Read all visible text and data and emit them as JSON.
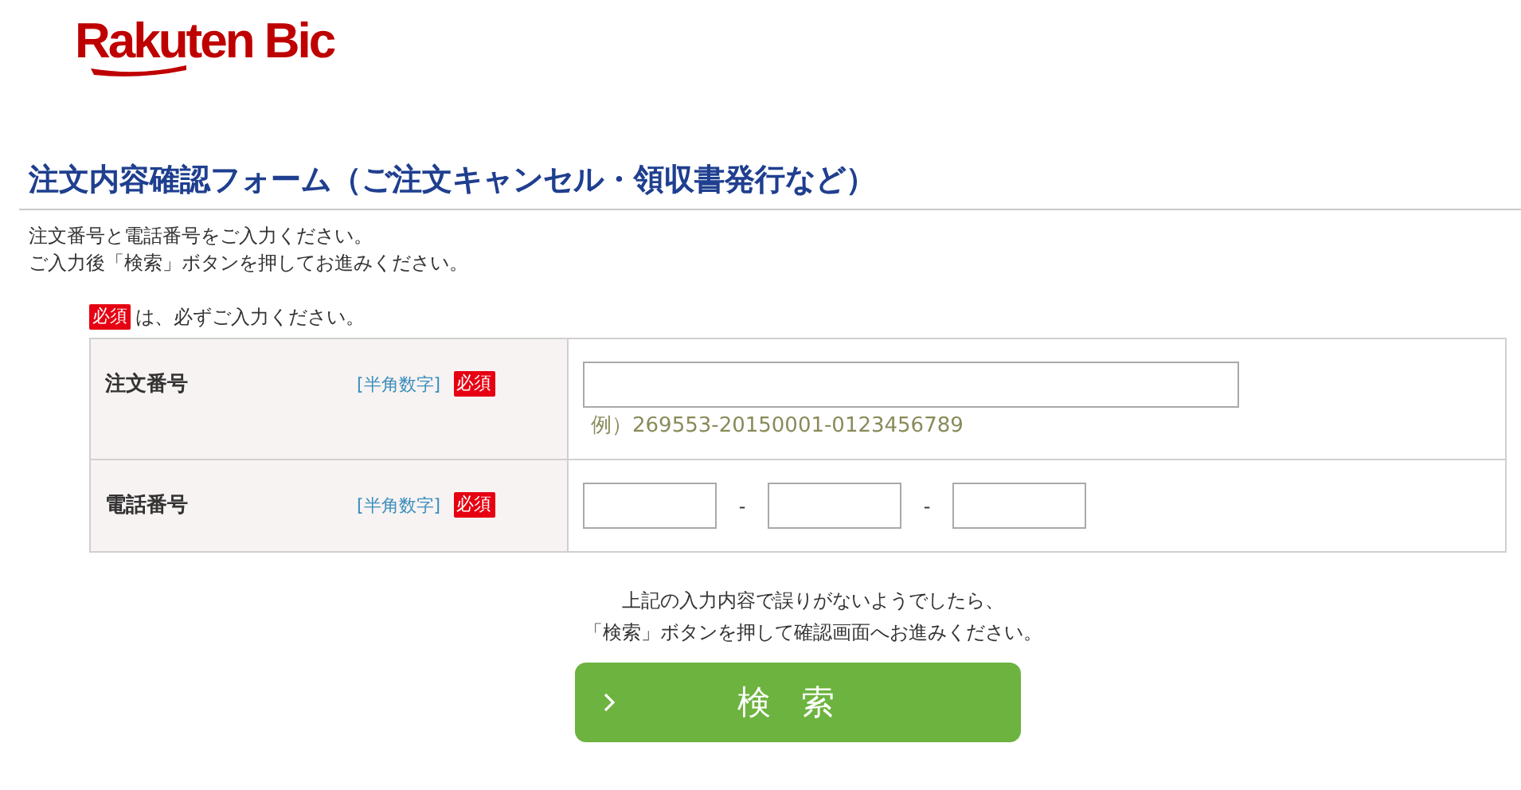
{
  "logo": {
    "text": "Rakuten Bic"
  },
  "heading": "注文内容確認フォーム（ご注文キャンセル・領収書発行など）",
  "intro": [
    "注文番号と電話番号をご入力ください。",
    "ご入力後「検索」ボタンを押してお進みください。"
  ],
  "required_note": {
    "badge": "必須",
    "text": "は、必ずご入力ください。"
  },
  "form_rows": [
    {
      "label": "注文番号",
      "hint": "[半角数字]",
      "badge": "必須",
      "kind": "single",
      "example": "例）269553-20150001-0123456789"
    },
    {
      "label": "電話番号",
      "hint": "[半角数字]",
      "badge": "必須",
      "kind": "phone",
      "separators": [
        "-",
        "-"
      ]
    }
  ],
  "notice": [
    "上記の入力内容で誤りがないようでしたら、",
    "「検索」ボタンを押して確認画面へお進みください。"
  ],
  "search_button": {
    "label": "検索"
  }
}
